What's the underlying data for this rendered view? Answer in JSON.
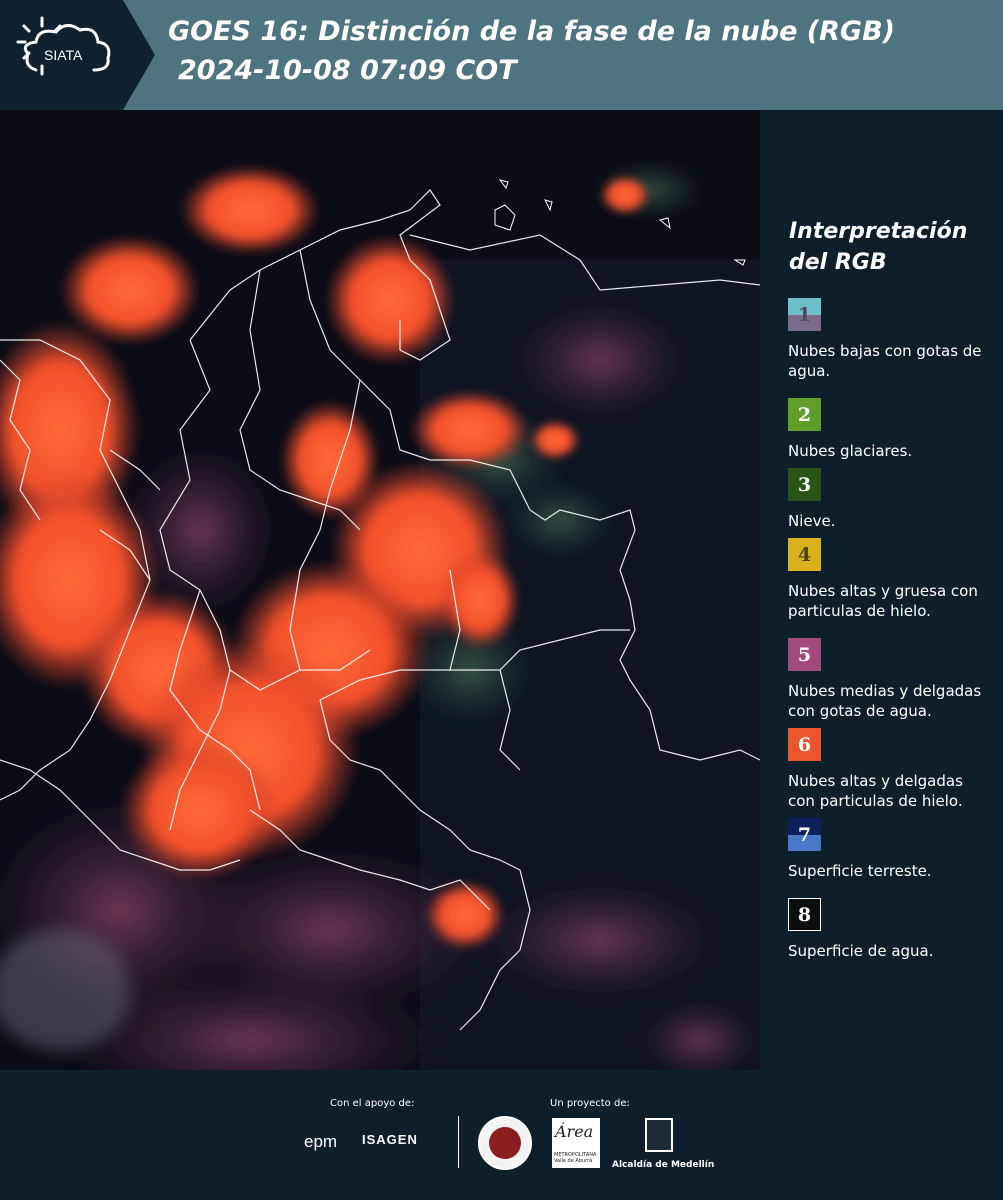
{
  "header": {
    "logo_text": "SIATA",
    "title_line1": "GOES 16: Distinción de la fase de la nube (RGB)",
    "title_line2": "2024-10-08 07:09 COT"
  },
  "legend": {
    "title": "Interpretación del RGB",
    "items": [
      {
        "num": "1",
        "label": "Nubes bajas con gotas de agua.",
        "top_color": "#6fbec9",
        "bottom_color": "#7a6b8c",
        "num_color": "#4a4a5a"
      },
      {
        "num": "2",
        "label": "Nubes glaciares.",
        "top_color": "#5f9e2b",
        "bottom_color": "#5f9e2b",
        "num_color": "#ffffff"
      },
      {
        "num": "3",
        "label": "Nieve.",
        "top_color": "#285517",
        "bottom_color": "#285517",
        "num_color": "#ffffff"
      },
      {
        "num": "4",
        "label": "Nubes altas y gruesa con particulas de hielo.",
        "top_color": "#d8b11c",
        "bottom_color": "#d8b11c",
        "num_color": "#4a3d10"
      },
      {
        "num": "5",
        "label": "Nubes medias y delgadas con gotas de agua.",
        "top_color": "#a04a80",
        "bottom_color": "#a04a80",
        "num_color": "#ffffff"
      },
      {
        "num": "6",
        "label": "Nubes altas y delgadas con particulas de hielo.",
        "top_color": "#e8552e",
        "bottom_color": "#e8552e",
        "num_color": "#ffffff"
      },
      {
        "num": "7",
        "label": "Superficie terreste.",
        "top_color": "#0c1f5e",
        "bottom_color": "#4a78c8",
        "num_color": "#ffffff"
      },
      {
        "num": "8",
        "label": "Superficie de agua.",
        "top_color": "#0b0f0d",
        "bottom_color": "#0b0f0d",
        "num_color": "#ffffff",
        "border_color": "#ffffff"
      }
    ]
  },
  "footer": {
    "support_label": "Con el apoyo de:",
    "project_label": "Un proyecto de:",
    "epm_logo": "epm",
    "isagen_logo": "ISAGEN",
    "area_logo": "Área",
    "area_small": "METROPOLITANA Valle de Aburrá",
    "medellin_logo": "Alcaldía de Medellín"
  },
  "colors": {
    "header_bg": "#4f7481",
    "logo_bg": "#0d2130",
    "page_bg": "#0e1f2c",
    "cloud_red": "#ff5a2e",
    "map_bg": "#0a0c16"
  }
}
